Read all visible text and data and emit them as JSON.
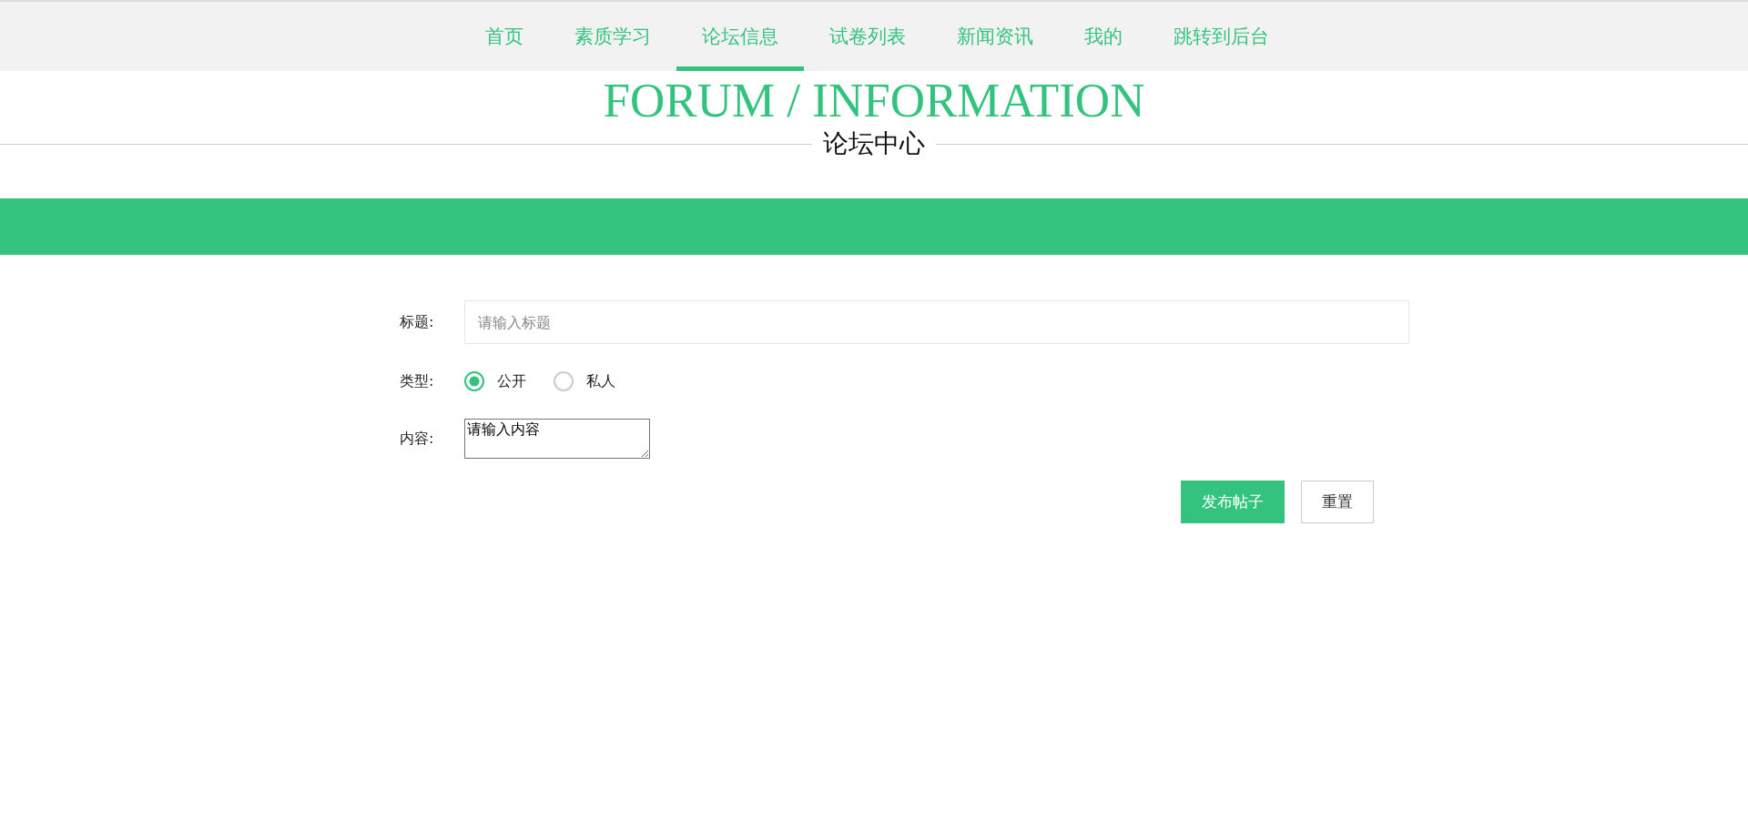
{
  "nav": {
    "items": [
      {
        "label": "首页",
        "selected": false
      },
      {
        "label": "素质学习",
        "selected": false
      },
      {
        "label": "论坛信息",
        "selected": true
      },
      {
        "label": "试卷列表",
        "selected": false
      },
      {
        "label": "新闻资讯",
        "selected": false
      },
      {
        "label": "我的",
        "selected": false
      },
      {
        "label": "跳转到后台",
        "selected": false
      }
    ]
  },
  "heading": {
    "title": "FORUM / INFORMATION",
    "subtitle": "论坛中心"
  },
  "form": {
    "title": {
      "label": "标题:",
      "placeholder": "请输入标题"
    },
    "type": {
      "label": "类型:",
      "options": [
        {
          "label": "公开",
          "selected": true
        },
        {
          "label": "私人",
          "selected": false
        }
      ]
    },
    "content": {
      "label": "内容:",
      "value": "请输入内容"
    },
    "buttons": [
      {
        "label": "发布帖子",
        "kind": "primary"
      },
      {
        "label": "重置",
        "kind": "plain"
      }
    ]
  }
}
